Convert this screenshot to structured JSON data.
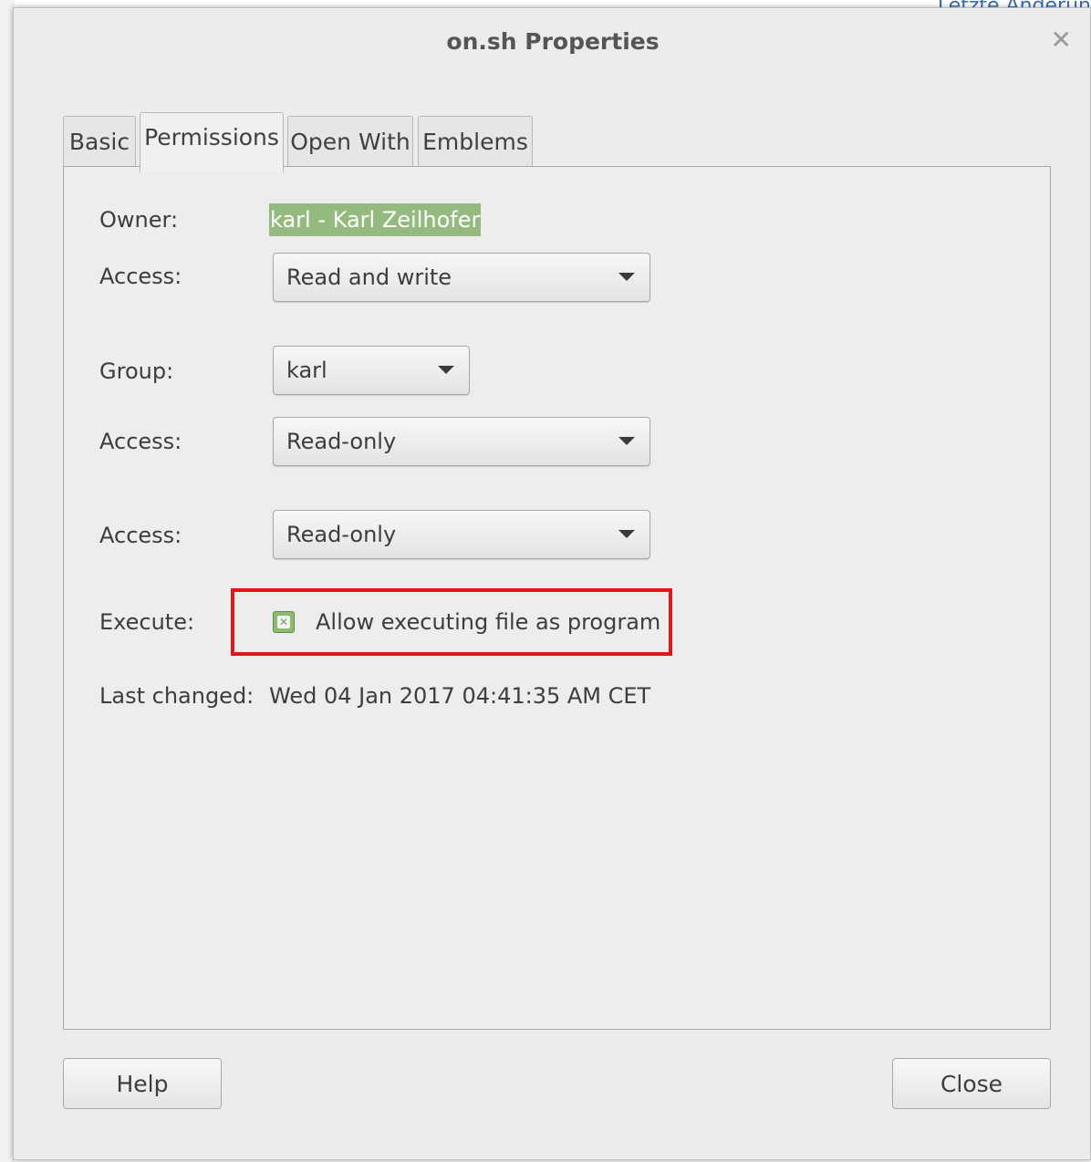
{
  "background": {
    "top_right_text": "Letzte Änderun"
  },
  "dialog": {
    "title": "on.sh Properties",
    "close_glyph": "✕"
  },
  "tabs": [
    {
      "label": "Basic",
      "active": false
    },
    {
      "label": "Permissions",
      "active": true
    },
    {
      "label": "Open With",
      "active": false
    },
    {
      "label": "Emblems",
      "active": false
    }
  ],
  "permissions": {
    "owner_label": "Owner:",
    "owner_value": "karl - Karl Zeilhofer",
    "owner_access_label": "Access:",
    "owner_access_value": "Read and write",
    "group_label": "Group:",
    "group_value": "karl",
    "group_access_label": "Access:",
    "group_access_value": "Read-only",
    "others_access_label": "Access:",
    "others_access_value": "Read-only",
    "execute_label": "Execute:",
    "execute_checkbox_label": "Allow executing file as program",
    "execute_checked": true,
    "last_changed_label": "Last changed:",
    "last_changed_value": "Wed 04 Jan 2017 04:41:35 AM CET"
  },
  "buttons": {
    "help": "Help",
    "close": "Close"
  },
  "colors": {
    "highlight_border": "#e0161b",
    "owner_selection": "#94ba7f",
    "checkbox_fill": "#8dbb6e"
  },
  "icons": {
    "close": "close-icon",
    "dropdown": "chevron-down-icon",
    "checkbox": "checkbox-checked-icon"
  }
}
